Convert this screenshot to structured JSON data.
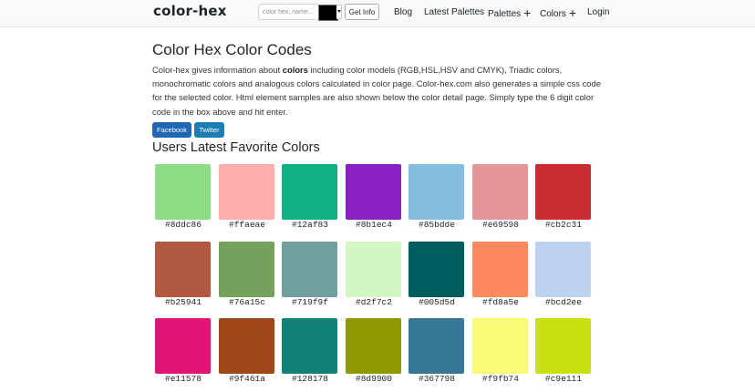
{
  "header": {
    "logo": "color-hex",
    "search_placeholder": "color hex, name...",
    "swatch_color": "#000000",
    "get_info_label": "Get Info",
    "nav": {
      "blog": "Blog",
      "latest_palettes": "Latest Palettes",
      "palettes": "Palettes",
      "colors": "Colors",
      "login": "Login",
      "plus": "+"
    }
  },
  "main": {
    "title": "Color Hex Color Codes",
    "intro_before": "Color-hex gives information about ",
    "intro_bold": "colors",
    "intro_after": " including color models (RGB,HSL,HSV and CMYK), Triadic colors, monochromatic colors and analogous colors calculated in color page. Color-hex.com also generates a simple css code for the selected color. Html element samples are also shown below the color detail page. Simply type the 6 digit color code in the box above and hit enter.",
    "facebook_label": "Facebook",
    "twitter_label": "Twitter",
    "favorites_title": "Users Latest Favorite Colors"
  },
  "favorite_colors": [
    [
      "#8ddc86",
      "#ffaeae",
      "#12af83",
      "#8b1ec4",
      "#85bdde",
      "#e69598",
      "#cb2c31"
    ],
    [
      "#b25941",
      "#76a15c",
      "#719f9f",
      "#d2f7c2",
      "#005d5d",
      "#fd8a5e",
      "#bcd2ee"
    ],
    [
      "#e11578",
      "#9f461a",
      "#128178",
      "#8d9900",
      "#367798",
      "#f9fb74",
      "#c9e111"
    ]
  ]
}
